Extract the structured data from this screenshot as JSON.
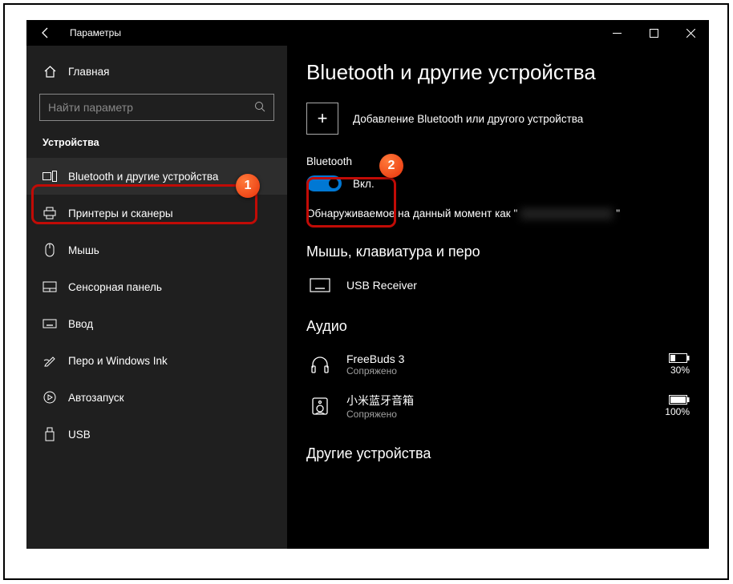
{
  "window": {
    "title": "Параметры"
  },
  "sidebar": {
    "home": "Главная",
    "search_placeholder": "Найти параметр",
    "section": "Устройства",
    "items": [
      {
        "label": "Bluetooth и другие устройства"
      },
      {
        "label": "Принтеры и сканеры"
      },
      {
        "label": "Мышь"
      },
      {
        "label": "Сенсорная панель"
      },
      {
        "label": "Ввод"
      },
      {
        "label": "Перо и Windows Ink"
      },
      {
        "label": "Автозапуск"
      },
      {
        "label": "USB"
      }
    ]
  },
  "main": {
    "title": "Bluetooth и другие устройства",
    "add_device": "Добавление Bluetooth или другого устройства",
    "bt_label": "Bluetooth",
    "toggle_state": "Вкл.",
    "discover_prefix": "Обнаруживаемое на данный момент как \"",
    "discover_suffix": "\"",
    "sections": {
      "mouse_kb": "Мышь, клавиатура и перо",
      "audio": "Аудио",
      "other": "Другие устройства"
    },
    "devices": {
      "usb_receiver": {
        "name": "USB Receiver"
      },
      "freebuds": {
        "name": "FreeBuds 3",
        "status": "Сопряжено",
        "battery": "30%"
      },
      "xiaomi": {
        "name": "小米蓝牙音箱",
        "status": "Сопряжено",
        "battery": "100%"
      }
    }
  },
  "annotation": {
    "badge1": "1",
    "badge2": "2"
  }
}
